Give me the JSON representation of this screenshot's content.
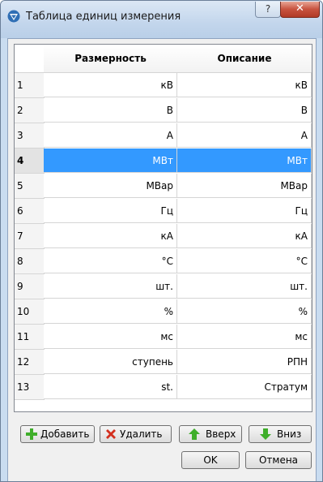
{
  "window": {
    "title": "Таблица единиц измерения",
    "help_label": "?",
    "close_label": "✕"
  },
  "table": {
    "columns": [
      "Размерность",
      "Описание"
    ],
    "rows": [
      {
        "num": "1",
        "dimension": "кВ",
        "description": "кВ"
      },
      {
        "num": "2",
        "dimension": "В",
        "description": "В"
      },
      {
        "num": "3",
        "dimension": "А",
        "description": "А"
      },
      {
        "num": "4",
        "dimension": "МВт",
        "description": "МВт"
      },
      {
        "num": "5",
        "dimension": "МВар",
        "description": "МВар"
      },
      {
        "num": "6",
        "dimension": "Гц",
        "description": "Гц"
      },
      {
        "num": "7",
        "dimension": "кА",
        "description": "кА"
      },
      {
        "num": "8",
        "dimension": "°С",
        "description": "°С"
      },
      {
        "num": "9",
        "dimension": "шт.",
        "description": "шт."
      },
      {
        "num": "10",
        "dimension": "%",
        "description": "%"
      },
      {
        "num": "11",
        "dimension": "мс",
        "description": "мс"
      },
      {
        "num": "12",
        "dimension": "ступень",
        "description": "РПН"
      },
      {
        "num": "13",
        "dimension": "st.",
        "description": "Стратум"
      }
    ],
    "selected_row": 4
  },
  "buttons": {
    "add": "Добавить",
    "delete": "Удалить",
    "up": "Вверх",
    "down": "Вниз",
    "ok": "OK",
    "cancel": "Отмена"
  },
  "colors": {
    "selection": "#3399ff",
    "add_icon": "#3fae2a",
    "delete_icon": "#d32f1e"
  }
}
